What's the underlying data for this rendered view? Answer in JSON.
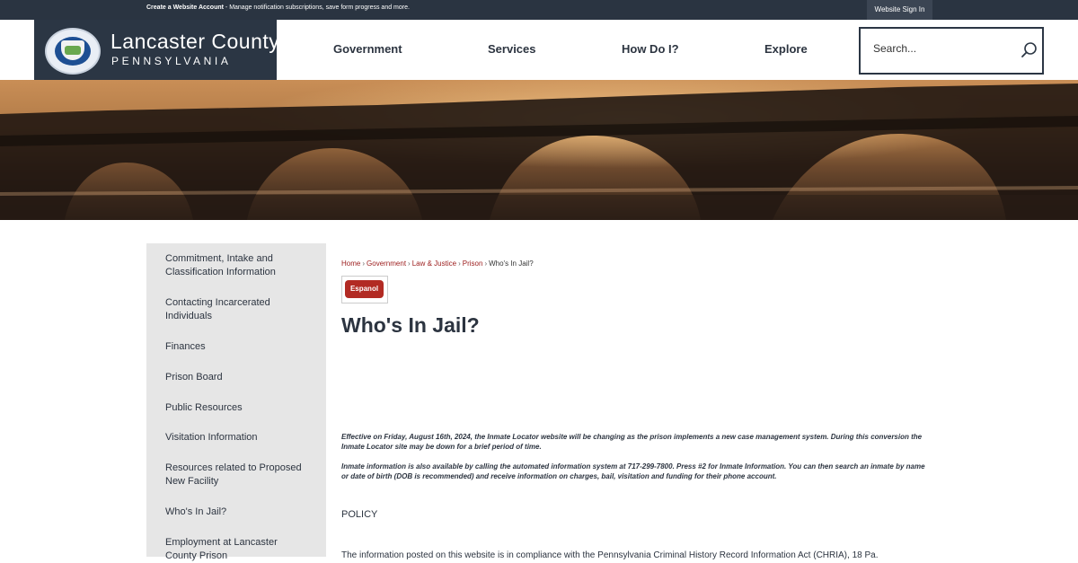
{
  "topbar": {
    "create_link": "Create a Website Account",
    "create_desc": " - Manage notification subscriptions, save form progress and more.",
    "signin": "Website Sign In"
  },
  "logo": {
    "name": "Lancaster County",
    "state": "PENNSYLVANIA"
  },
  "nav": {
    "items": [
      "Government",
      "Services",
      "How Do I?",
      "Explore"
    ]
  },
  "search": {
    "placeholder": "Search..."
  },
  "sidebar": {
    "items": [
      "Commitment, Intake and Classification Information",
      "Contacting Incarcerated Individuals",
      "Finances",
      "Prison Board",
      "Public Resources",
      "Visitation Information",
      "Resources related to Proposed New Facility",
      "Who's In Jail?",
      "Employment at Lancaster County Prison"
    ]
  },
  "breadcrumb": {
    "items": [
      "Home",
      "Government",
      "Law & Justice",
      "Prison"
    ],
    "current": "Who's In Jail?"
  },
  "espanol": "Espanol",
  "page_title": "Who's In Jail?",
  "notice1": "Effective on Friday, August 16th, 2024, the Inmate Locator website will be changing as the prison implements a new case management system. During this conversion the Inmate Locator site may be down for a brief period of time.",
  "notice2": "Inmate information is also available by calling the automated information system at 717-299-7800.  Press #2 for Inmate Information.  You can then search an inmate by name or date of birth (DOB is recommended) and receive information on charges, bail, visitation and funding for their phone account.",
  "policy_heading": "POLICY",
  "policy_text": "The information posted on this website is in compliance with the Pennsylvania Criminal History Record Information Act (CHRIA), 18 Pa.",
  "colors": {
    "navy": "#2b3644",
    "accent_red": "#b22a23",
    "link_red": "#9b1b1b",
    "sidebar_bg": "#e6e6e6"
  },
  "icons": {
    "search": "magnifier-icon",
    "seal": "county-seal-icon"
  }
}
